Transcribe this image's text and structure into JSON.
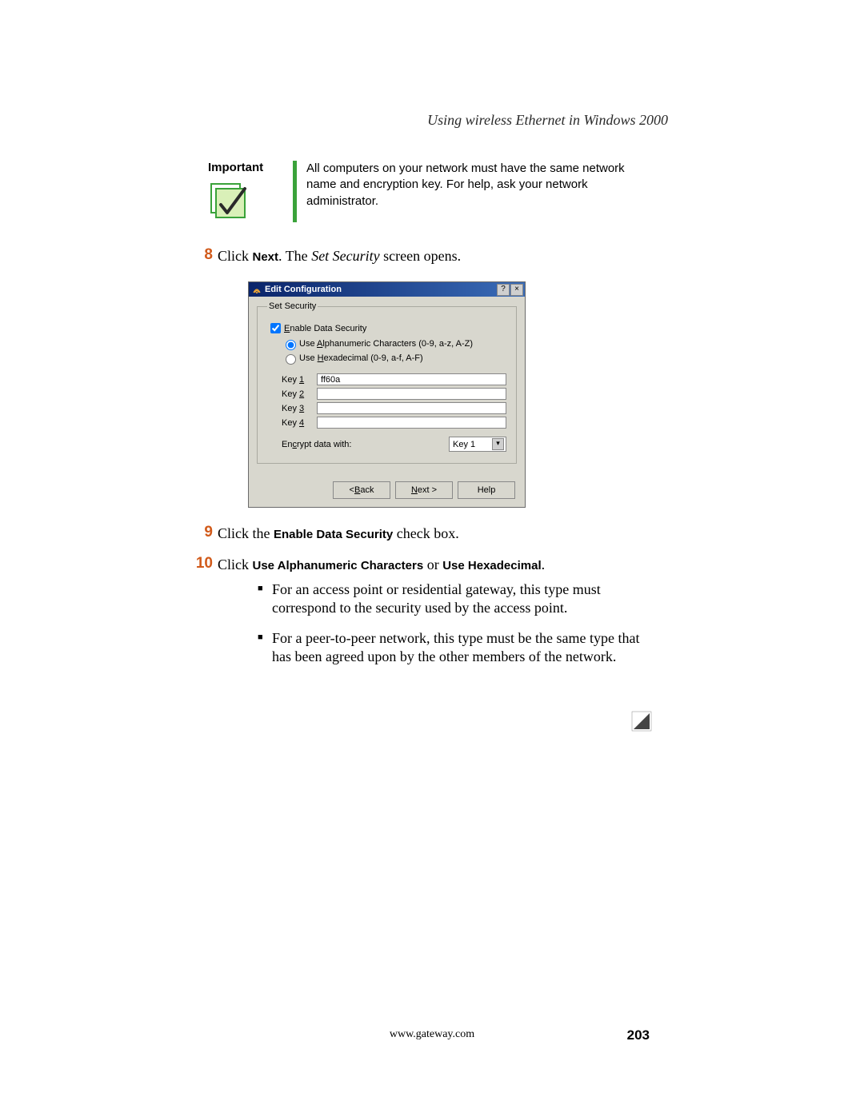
{
  "header": {
    "title": "Using wireless Ethernet in Windows 2000"
  },
  "important": {
    "label": "Important",
    "text": "All computers on your network must have the same network name and encryption key. For help, ask your network administrator."
  },
  "steps": {
    "s8_num": "8",
    "s8_a": "Click ",
    "s8_b": "Next",
    "s8_c": ". The ",
    "s8_d": "Set Security",
    "s8_e": " screen opens.",
    "s9_num": "9",
    "s9_a": "Click the ",
    "s9_b": "Enable Data Security",
    "s9_c": " check box.",
    "s10_num": "10",
    "s10_a": "Click ",
    "s10_b": "Use Alphanumeric Characters",
    "s10_c": " or ",
    "s10_d": "Use Hexadecimal",
    "s10_e": "."
  },
  "bullets": {
    "b1": "For an access point or residential gateway, this type must correspond to the security used by the access point.",
    "b2": "For a peer-to-peer network, this type must be the same type that has been agreed upon by the other members of the network."
  },
  "dialog": {
    "title": "Edit Configuration",
    "help_btn": "?",
    "close_btn": "×",
    "group_legend": "Set Security",
    "enable_label": "Enable Data Security",
    "radio_alpha": "Use Alphanumeric Characters (0-9, a-z, A-Z)",
    "radio_hex": "Use Hexadecimal (0-9, a-f, A-F)",
    "key1_label": "Key 1",
    "key2_label": "Key 2",
    "key3_label": "Key 3",
    "key4_label": "Key 4",
    "key1_value": "ff60a",
    "encrypt_label": "Encrypt data with:",
    "encrypt_value": "Key 1",
    "back_btn": "< Back",
    "next_btn": "Next >",
    "help_btn2": "Help"
  },
  "footer": {
    "url": "www.gateway.com",
    "page": "203"
  }
}
